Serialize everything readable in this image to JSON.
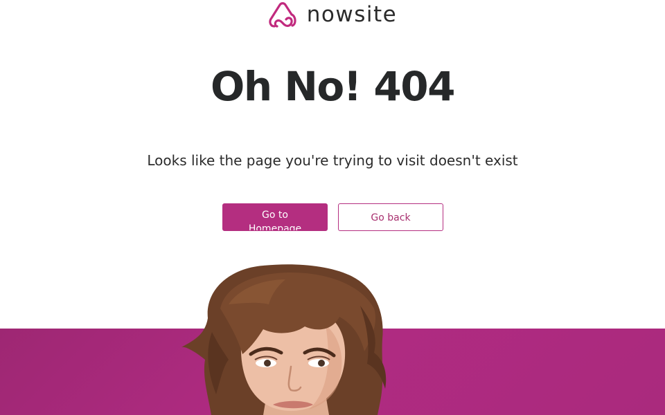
{
  "brand": {
    "name": "nowsite",
    "logo_icon": "nowsite-logo-icon",
    "accent_color": "#b42e80"
  },
  "error": {
    "headline": "Oh No! 404",
    "message": "Looks like the page you're trying to visit doesn't exist"
  },
  "actions": {
    "homepage_label": "Go to Homepage",
    "back_label": "Go back"
  },
  "hero": {
    "image": "confused-woman-photo",
    "band_color": "#b02b82"
  }
}
